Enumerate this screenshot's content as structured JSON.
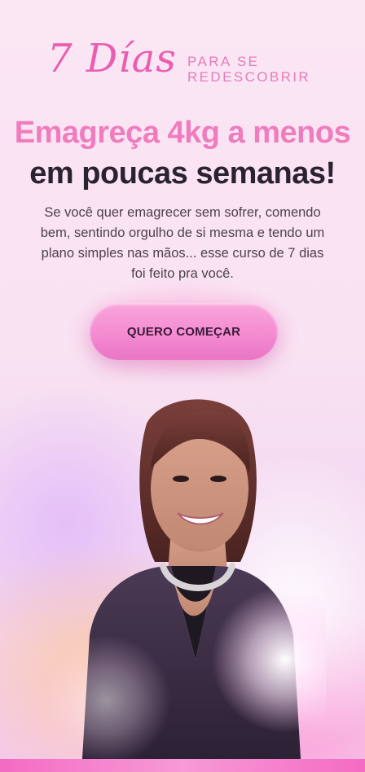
{
  "brand": {
    "script": "7 Días",
    "tagline_line1": "PARA SE",
    "tagline_line2": "REDESCOBRIR"
  },
  "headline": {
    "line1": "Emagreça 4kg a menos",
    "line2": "em poucas semanas!"
  },
  "subtext": "Se você quer emagrecer sem sofrer, comendo bem, sentindo orgulho de si mesma e tendo um plano simples nas mãos... esse curso de 7 dias foi feito pra você.",
  "cta": {
    "label": "QUERO COMEÇAR"
  },
  "colors": {
    "accent_pink": "#f07cbe",
    "button_pink": "#f48bd1",
    "headline_dark": "#2b2230"
  }
}
